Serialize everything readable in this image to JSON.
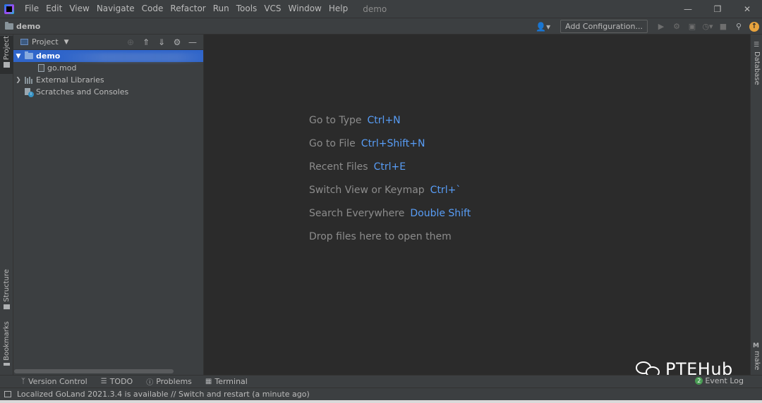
{
  "menubar": {
    "items": [
      "File",
      "Edit",
      "View",
      "Navigate",
      "Code",
      "Refactor",
      "Run",
      "Tools",
      "VCS",
      "Window",
      "Help"
    ],
    "project_name": "demo",
    "icons": {
      "minimize": "minimize-icon",
      "restore": "restore-icon",
      "close": "close-icon"
    }
  },
  "navbar": {
    "breadcrumb": "demo",
    "add_configuration": "Add Configuration...",
    "update_badge": "↑"
  },
  "left_strip": {
    "project": "Project",
    "structure": "Structure",
    "bookmarks": "Bookmarks"
  },
  "right_strip": {
    "database": "Database",
    "make": "make"
  },
  "project_panel": {
    "title": "Project",
    "tree": [
      {
        "label": "demo",
        "type": "folder",
        "expanded": true,
        "selected": true
      },
      {
        "label": "go.mod",
        "type": "file"
      },
      {
        "label": "External Libraries",
        "type": "library",
        "expanded": false
      },
      {
        "label": "Scratches and Consoles",
        "type": "scratch"
      }
    ]
  },
  "editor": {
    "hints": [
      {
        "text": "Go to Type",
        "shortcut": "Ctrl+N"
      },
      {
        "text": "Go to File",
        "shortcut": "Ctrl+Shift+N"
      },
      {
        "text": "Recent Files",
        "shortcut": "Ctrl+E"
      },
      {
        "text": "Switch View or Keymap",
        "shortcut": "Ctrl+`"
      },
      {
        "text": "Search Everywhere",
        "shortcut": "Double Shift"
      },
      {
        "text": "Drop files here to open them",
        "shortcut": ""
      }
    ]
  },
  "bottom_tools": {
    "version_control": "Version Control",
    "todo": "TODO",
    "problems": "Problems",
    "terminal": "Terminal",
    "event_log": "Event Log",
    "event_count": "2"
  },
  "watermark": "PTEHub",
  "status": {
    "message": "Localized GoLand 2021.3.4 is available // Switch and restart (a minute ago)"
  },
  "colors": {
    "background": "#2b2b2b",
    "panel": "#3c3f41",
    "selection": "#2f65ca",
    "shortcut": "#589df6",
    "update": "#e8a33d"
  }
}
